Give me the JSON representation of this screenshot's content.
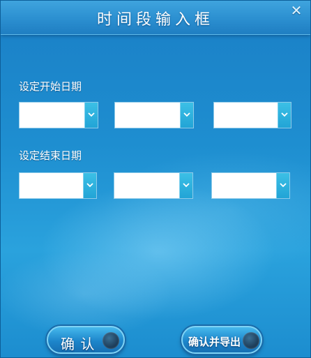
{
  "title": "时间段输入框",
  "close_icon": "close-icon",
  "start": {
    "label": "设定开始日期",
    "selects": [
      {
        "value": ""
      },
      {
        "value": ""
      },
      {
        "value": ""
      }
    ]
  },
  "end": {
    "label": "设定结束日期",
    "selects": [
      {
        "value": ""
      },
      {
        "value": ""
      },
      {
        "value": ""
      }
    ]
  },
  "buttons": {
    "confirm": "确 认",
    "confirm_export": "确认并导出"
  },
  "colors": {
    "accent": "#22a4d6",
    "titlebar": "#2b8fd0"
  }
}
